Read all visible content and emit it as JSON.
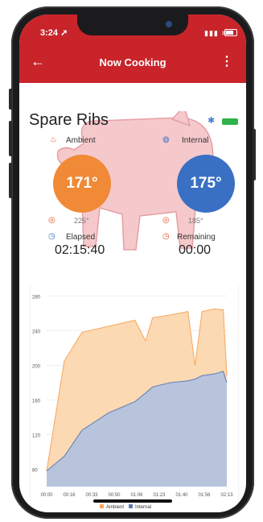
{
  "status_bar": {
    "time": "3:24 ➚",
    "signal": "▮▮▮ ≋"
  },
  "app_bar": {
    "back_icon": "←",
    "title": "Now Cooking",
    "menu_icon": "⋮"
  },
  "food": {
    "name": "Spare Ribs"
  },
  "probes": {
    "ambient": {
      "label": "Ambient",
      "temp": "171°",
      "target": "225°",
      "color": "#f08a37"
    },
    "internal": {
      "label": "Internal",
      "temp": "175°",
      "target": "185°",
      "color": "#3a70c3"
    }
  },
  "timers": {
    "elapsed": {
      "label": "Elapsed",
      "value": "02:15:40"
    },
    "remaining": {
      "label": "Remaining",
      "value": "00:00"
    }
  },
  "chart_data": {
    "type": "area",
    "x": [
      "00:00",
      "00:16",
      "00:33",
      "00:50",
      "01:06",
      "01:23",
      "01:40",
      "01:56",
      "02:13"
    ],
    "yticks": [
      80,
      120,
      160,
      200,
      240,
      280
    ],
    "ylim": [
      60,
      285
    ],
    "series": [
      {
        "name": "Ambient",
        "color": "#f7a55c",
        "fill": "#fbd9b2",
        "values": [
          78,
          205,
          238,
          245,
          252,
          228,
          255,
          258,
          262,
          200,
          262,
          265,
          264,
          188
        ]
      },
      {
        "name": "Internal",
        "color": "#5a7ab5",
        "fill": "#b8c4dc",
        "values": [
          78,
          95,
          125,
          145,
          158,
          168,
          175,
          180,
          182,
          184,
          188,
          190,
          193,
          180
        ]
      }
    ],
    "xs": [
      0,
      0.1,
      0.2,
      0.35,
      0.5,
      0.56,
      0.6,
      0.7,
      0.8,
      0.84,
      0.88,
      0.95,
      1.0,
      1.02
    ]
  }
}
